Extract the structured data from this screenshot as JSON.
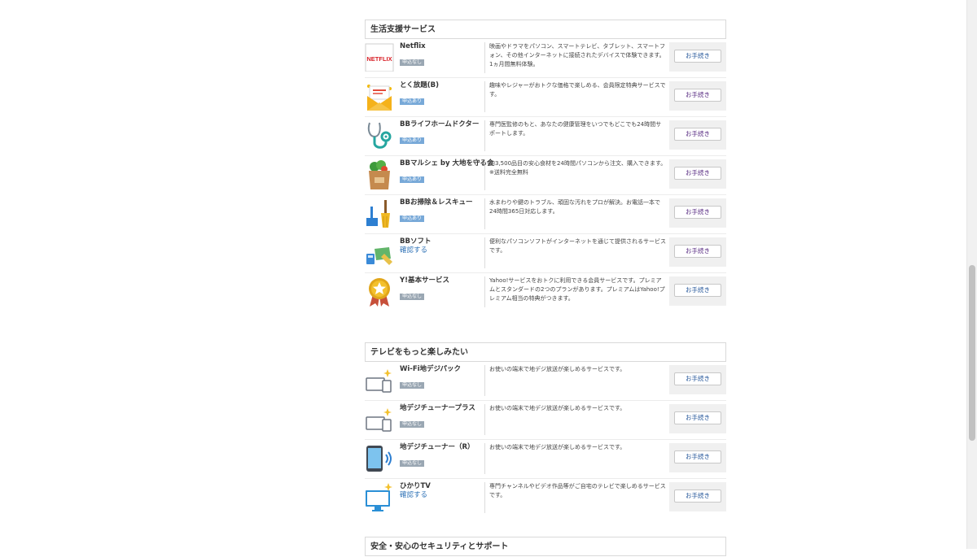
{
  "sections": [
    {
      "title": "生活支援サービス",
      "rows": [
        {
          "name": "Netflix",
          "badge": "申込なし",
          "desc": "映画やドラマをパソコン、スマートテレビ、タブレット、スマートフォン、その他インターネットに接続されたデバイスで体験できます。1ヵ月間無料体験。",
          "button": "お手続き"
        },
        {
          "name": "とく放題(B)",
          "badge": "申込あり",
          "desc": "趣味やレジャーがおトクな価格で楽しめる、会員限定特典サービスです。",
          "button": "お手続き"
        },
        {
          "name": "BBライフホームドクター",
          "badge": "申込あり",
          "desc": "専門医監修のもと、あなたの健康管理をいつでもどこでも24時間サポートします。",
          "button": "お手続き"
        },
        {
          "name": "BBマルシェ by 大地を守る会",
          "badge": "申込あり",
          "desc": "約3,500品目の安心食材を24時間パソコンから注文、購入できます。",
          "note": "※送料完全無料",
          "button": "お手続き"
        },
        {
          "name": "BBお掃除＆レスキュー",
          "badge": "申込あり",
          "desc": "水まわりや鍵のトラブル、頑固な汚れをプロが解決。お電話一本で24時間365日対応します。",
          "button": "お手続き"
        },
        {
          "name": "BBソフト",
          "link": "確認する",
          "desc": "便利なパソコンソフトがインターネットを通じて提供されるサービスです。",
          "button": "お手続き"
        },
        {
          "name": "Y!基本サービス",
          "badge": "申込なし",
          "desc": "Yahoo!サービスをおトクに利用できる会員サービスです。プレミアムとスタンダードの2つのプランがあります。プレミアムはYahoo!プレミアム相当の特典がつきます。",
          "button": "お手続き"
        }
      ]
    },
    {
      "title": "テレビをもっと楽しみたい",
      "rows": [
        {
          "name": "Wi-Fi地デジパック",
          "badge": "申込なし",
          "desc": "お使いの端末で地デジ放送が楽しめるサービスです。",
          "button": "お手続き"
        },
        {
          "name": "地デジチューナープラス",
          "badge": "申込なし",
          "desc": "お使いの端末で地デジ放送が楽しめるサービスです。",
          "button": "お手続き"
        },
        {
          "name": "地デジチューナー（R）",
          "badge": "申込なし",
          "desc": "お使いの端末で地デジ放送が楽しめるサービスです。",
          "button": "お手続き"
        },
        {
          "name": "ひかりTV",
          "link": "確認する",
          "desc": "専門チャンネルやビデオ作品等がご自宅のテレビで楽しめるサービスです。",
          "button": "お手続き"
        }
      ]
    },
    {
      "title": "安全・安心のセキュリティとサポート"
    }
  ],
  "icons": {
    "netflix_text": "NETFLIX"
  }
}
